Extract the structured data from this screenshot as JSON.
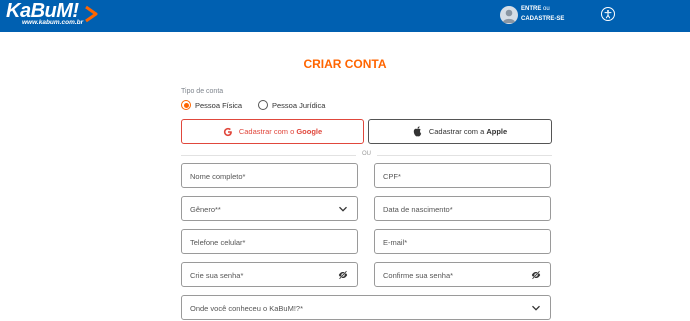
{
  "header": {
    "logo_text": "KaBuM!",
    "logo_url_text": "www.kabum.com.br",
    "login_prefix": "ENTRE",
    "login_mid": "ou",
    "register_label": "CADASTRE-SE",
    "brand_color": "#0060b1"
  },
  "form": {
    "title": "CRIAR CONTA",
    "account_type_label": "Tipo de conta",
    "account_types": [
      {
        "label": "Pessoa Física",
        "checked": true
      },
      {
        "label": "Pessoa Jurídica",
        "checked": false
      }
    ],
    "google_button": {
      "prefix": "Cadastrar com o",
      "brand": "Google"
    },
    "apple_button": {
      "prefix": "Cadastrar com a",
      "brand": "Apple"
    },
    "or_label": "OU",
    "fields": {
      "full_name": "Nome completo*",
      "cpf": "CPF*",
      "gender": "Gênero**",
      "birth_date": "Data de nascimento*",
      "mobile_phone": "Telefone celular*",
      "email": "E-mail*",
      "password": "Crie sua senha*",
      "confirm_password": "Confirme sua senha*",
      "referral": "Onde você conheceu o KaBuM!?*"
    },
    "accent_color": "#ff6500"
  }
}
